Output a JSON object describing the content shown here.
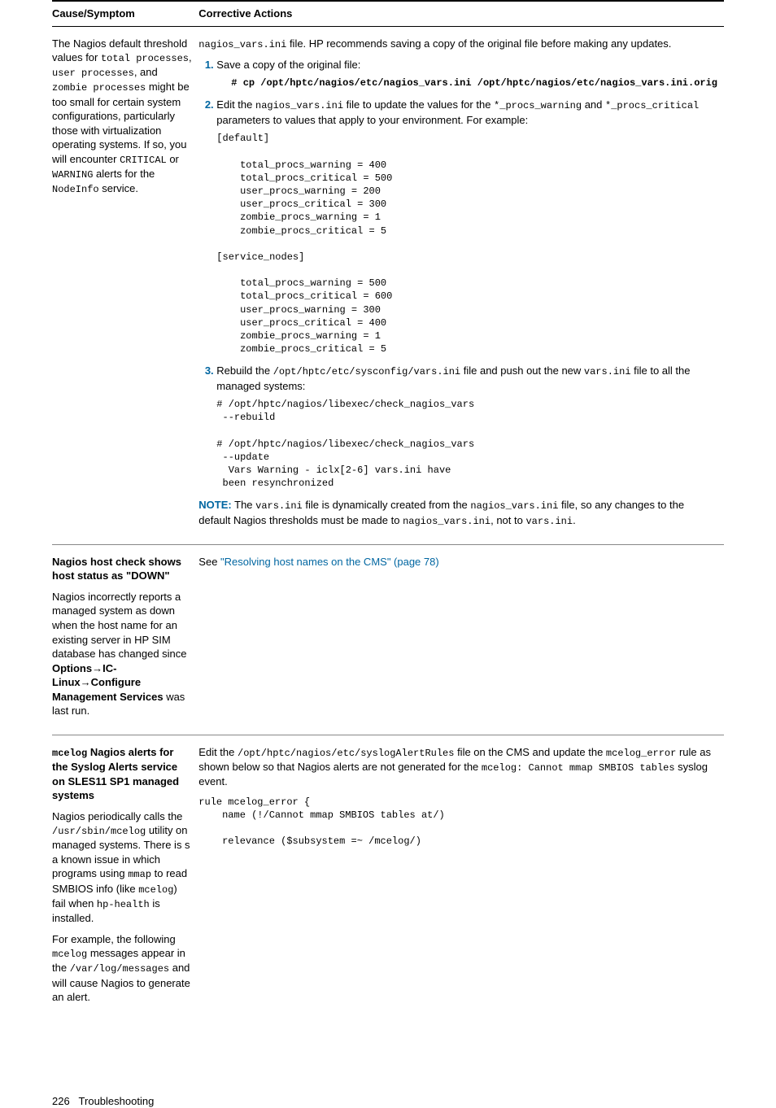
{
  "table": {
    "headers": {
      "left": "Cause/Symptom",
      "right": "Corrective Actions"
    }
  },
  "row1": {
    "left": {
      "p1a": "The Nagios default threshold values for ",
      "c1": "total processes",
      "p1b": ", ",
      "c2": "user processes",
      "p1c": ", and ",
      "c3": "zombie processes",
      "p1d": " might be too small for certain system configurations, particularly those with virtualization operating systems. If so, you will encounter ",
      "c4": "CRITICAL",
      "p1e": " or ",
      "c5": "WARNING",
      "p1f": " alerts for the ",
      "c6": "NodeInfo",
      "p1g": " service."
    },
    "right": {
      "intro_code": "nagios_vars.ini",
      "intro_rest": " file. HP recommends saving a copy of the original file before making any updates.",
      "li1": "Save a copy of the original file:",
      "code1": "# cp /opt/hptc/nagios/etc/nagios_vars.ini /opt/hptc/nagios/etc/nagios_vars.ini.orig",
      "li2a": "Edit the ",
      "li2c1": "nagios_vars.ini",
      "li2b": " file to update the values for the ",
      "li2c2": "*_procs_warning",
      "li2c": " and ",
      "li2c3": "*_procs_critical",
      "li2d": " parameters to values that apply to your environment. For example:",
      "codeA": "[default]\n\n    total_procs_warning = 400\n    total_procs_critical = 500\n    user_procs_warning = 200\n    user_procs_critical = 300\n    zombie_procs_warning = 1\n    zombie_procs_critical = 5\n\n[service_nodes]\n\n    total_procs_warning = 500\n    total_procs_critical = 600\n    user_procs_warning = 300\n    user_procs_critical = 400\n    zombie_procs_warning = 1\n    zombie_procs_critical = 5",
      "li3a": "Rebuild the ",
      "li3c1": "/opt/hptc/etc/sysconfig/vars.ini",
      "li3b": " file and push out the new ",
      "li3c2": "vars.ini",
      "li3c": " file to all the managed systems:",
      "codeB": "# /opt/hptc/nagios/libexec/check_nagios_vars\n --rebuild\n\n# /opt/hptc/nagios/libexec/check_nagios_vars\n --update\n  Vars Warning - iclx[2-6] vars.ini have\n been resynchronized",
      "note_label": "NOTE:",
      "note_a": "   The ",
      "note_c1": "vars.ini",
      "note_b": " file is dynamically created from the ",
      "note_c2": "nagios_vars.ini",
      "note_c": " file, so any changes to the default Nagios thresholds must be made to ",
      "note_c3": "nagios_vars.ini",
      "note_d": ", not to ",
      "note_c4": "vars.ini",
      "note_e": "."
    }
  },
  "row2": {
    "left": {
      "h": "Nagios host check shows host status as \"DOWN\"",
      "p_a": "Nagios incorrectly reports a managed system as down when the host name for an existing server in HP SIM database has changed since ",
      "b1": "Options",
      "arrow1": "→",
      "b2": "IC-Linux",
      "arrow2": "→",
      "b3": "Configure Management Services",
      "p_b": " was last run."
    },
    "right": {
      "a": "See ",
      "link": "\"Resolving host names on the CMS\" (page 78)"
    }
  },
  "row3": {
    "left": {
      "h_c": "mcelog",
      "h_r": " Nagios alerts for the Syslog Alerts service on SLES11 SP1 managed systems",
      "p1a": "Nagios periodically calls the ",
      "c1": "/usr/sbin/mcelog",
      "p1b": " utility on managed systems. There is s a known issue in which programs using ",
      "c2": "mmap",
      "p1c": " to read SMBIOS info (like ",
      "c3": "mcelog",
      "p1d": ") fail when ",
      "c4": "hp-health",
      "p1e": " is installed.",
      "p2a": "For example, the following ",
      "c5": "mcelog",
      "p2b": " messages appear in the ",
      "c6": "/var/log/messages",
      "p2c": " and will cause Nagios to generate an alert."
    },
    "right": {
      "p1a": "Edit the ",
      "c1": "/opt/hptc/nagios/etc/syslogAlertRules",
      "p1b": " file on the CMS and update the ",
      "c2": "mcelog_error",
      "p1c": " rule as shown below so that Nagios alerts are not generated for the ",
      "c3": "mcelog: Cannot mmap SMBIOS tables",
      "p1d": " syslog event.",
      "code": "rule mcelog_error {\n    name (!/Cannot mmap SMBIOS tables at/)\n\n    relevance ($subsystem =~ /mcelog/)"
    }
  },
  "footer": {
    "page": "226",
    "title": "Troubleshooting"
  }
}
